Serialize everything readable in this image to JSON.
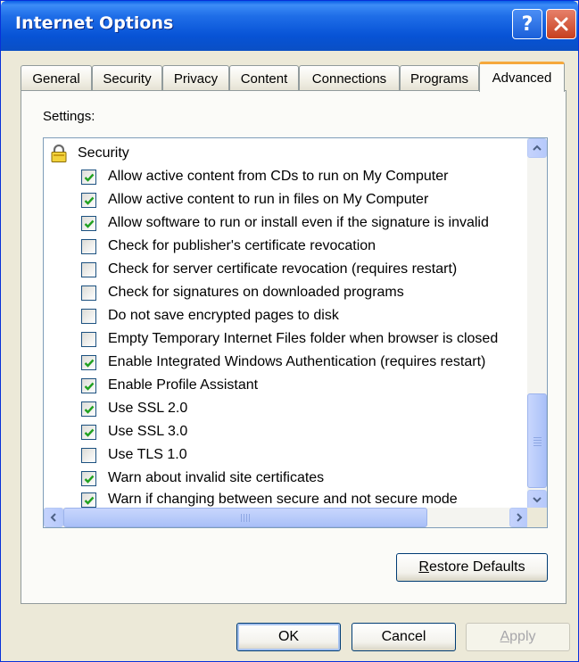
{
  "window": {
    "title": "Internet Options"
  },
  "tabs": [
    {
      "label": "General"
    },
    {
      "label": "Security"
    },
    {
      "label": "Privacy"
    },
    {
      "label": "Content"
    },
    {
      "label": "Connections"
    },
    {
      "label": "Programs"
    },
    {
      "label": "Advanced",
      "active": true
    }
  ],
  "advanced": {
    "settings_label": "Settings:",
    "group": {
      "label": "Security",
      "icon": "lock-icon"
    },
    "items": [
      {
        "label": "Allow active content from CDs to run on My Computer",
        "checked": true
      },
      {
        "label": "Allow active content to run in files on My Computer",
        "checked": true
      },
      {
        "label": "Allow software to run or install even if the signature is invalid",
        "checked": true
      },
      {
        "label": "Check for publisher's certificate revocation",
        "checked": false
      },
      {
        "label": "Check for server certificate revocation (requires restart)",
        "checked": false
      },
      {
        "label": "Check for signatures on downloaded programs",
        "checked": false
      },
      {
        "label": "Do not save encrypted pages to disk",
        "checked": false
      },
      {
        "label": "Empty Temporary Internet Files folder when browser is closed",
        "checked": false
      },
      {
        "label": "Enable Integrated Windows Authentication (requires restart)",
        "checked": true
      },
      {
        "label": "Enable Profile Assistant",
        "checked": true
      },
      {
        "label": "Use SSL 2.0",
        "checked": true
      },
      {
        "label": "Use SSL 3.0",
        "checked": true
      },
      {
        "label": "Use TLS 1.0",
        "checked": false
      },
      {
        "label": "Warn about invalid site certificates",
        "checked": true
      },
      {
        "label": "Warn if changing between secure and not secure mode",
        "checked": true
      }
    ],
    "restore_defaults": "Restore Defaults"
  },
  "footer": {
    "ok": "OK",
    "cancel": "Cancel",
    "apply": "Apply"
  },
  "colors": {
    "titlebar": "#0753d6",
    "dialog_bg": "#ece9d8",
    "check_mark": "#21a121",
    "active_tab_accent": "#f5a83b"
  }
}
